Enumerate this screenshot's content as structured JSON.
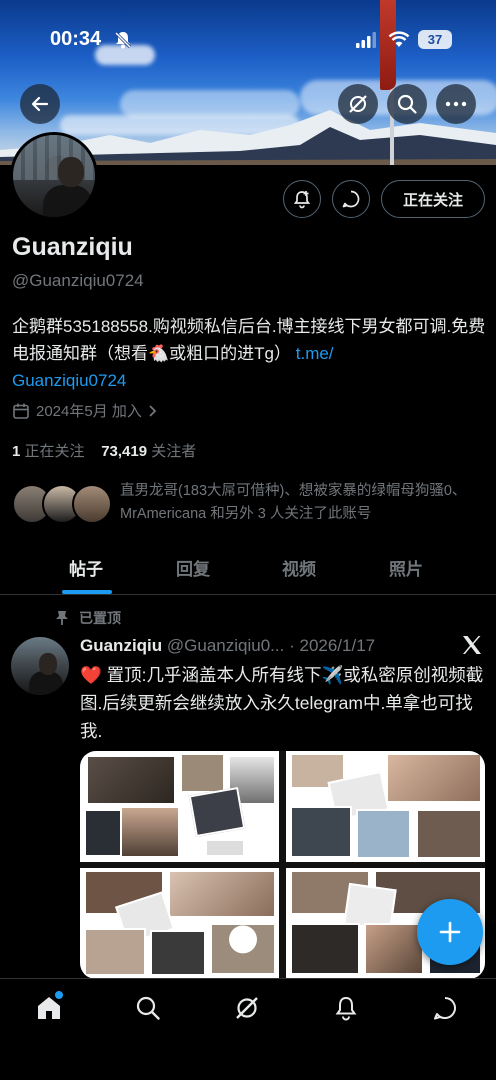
{
  "status_bar": {
    "time": "00:34",
    "battery": "37"
  },
  "profile": {
    "name": "Guanziqiu",
    "handle": "@Guanziqiu0724",
    "bio_text": "企鹅群535188558.购视频私信后台.博主接线下男女都可调.免费电报通知群（想看🐔或粗口的进Tg）",
    "bio_link": "t.me/\nGuanziqiu0724",
    "joined": "2024年5月 加入",
    "following_count": "1",
    "following_label": "正在关注",
    "followers_count": "73,419",
    "followers_label": "关注者",
    "follow_button": "正在关注",
    "mutuals_text": "直男龙哥(183大屌可借种)、想被家暴的绿帽母狗骚0、MrAmericana 和另外 3 人关注了此账号"
  },
  "tabs": [
    {
      "label": "帖子",
      "active": true
    },
    {
      "label": "回复",
      "active": false
    },
    {
      "label": "视频",
      "active": false
    },
    {
      "label": "照片",
      "active": false
    }
  ],
  "post": {
    "pinned_label": "已置顶",
    "author_name": "Guanziqiu",
    "author_handle": "@Guanziqiu0...",
    "separator": "·",
    "date": "2026/1/17",
    "text": "❤️ 置顶:几乎涵盖本人所有线下✈️或私密原创视频截图.后续更新会继续放入永久telegram中.单拿也可找我."
  },
  "colors": {
    "accent": "#1d9bf0",
    "background": "#000000",
    "muted": "#71767b"
  },
  "icons": [
    "back-arrow-icon",
    "grok-icon",
    "search-icon",
    "more-icon",
    "notification-add-icon",
    "message-icon",
    "calendar-icon",
    "pin-icon",
    "x-logo-icon",
    "plus-icon",
    "home-icon",
    "explore-icon",
    "grok-nav-icon",
    "bell-icon",
    "mail-icon"
  ]
}
